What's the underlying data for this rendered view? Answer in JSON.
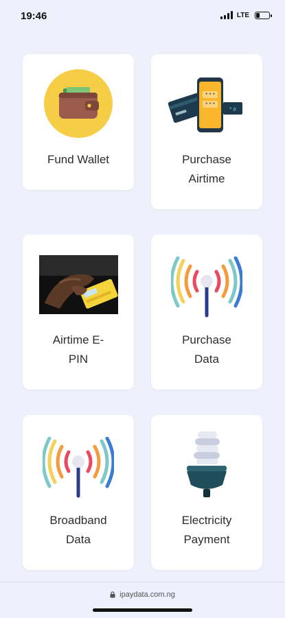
{
  "status_bar": {
    "time": "19:46",
    "network": "LTE"
  },
  "services": [
    {
      "label": "Fund Wallet",
      "icon": "wallet-icon"
    },
    {
      "label": "Purchase Airtime",
      "icon": "phone-cards-icon"
    },
    {
      "label": "Airtime E-PIN",
      "icon": "recharge-card-photo"
    },
    {
      "label": "Purchase Data",
      "icon": "signal-broadcast-icon"
    },
    {
      "label": "Broadband Data",
      "icon": "signal-broadcast-icon"
    },
    {
      "label": "Electricity Payment",
      "icon": "light-bulb-icon"
    }
  ],
  "browser_bar": {
    "url": "ipaydata.com.ng"
  },
  "colors": {
    "background": "#eef1fb",
    "card": "#ffffff",
    "wallet_circle": "#f5cd47",
    "wallet_brown": "#9a5a4c",
    "phone_yellow": "#f9b52b",
    "card_navy": "#1c3a4c",
    "signal_red": "#e84a5f",
    "signal_orange": "#f49b3f",
    "signal_yellow": "#f5d15c",
    "signal_teal": "#7ec8c8",
    "signal_blue": "#3a7bd5",
    "bulb_teal": "#1f4e5a"
  }
}
